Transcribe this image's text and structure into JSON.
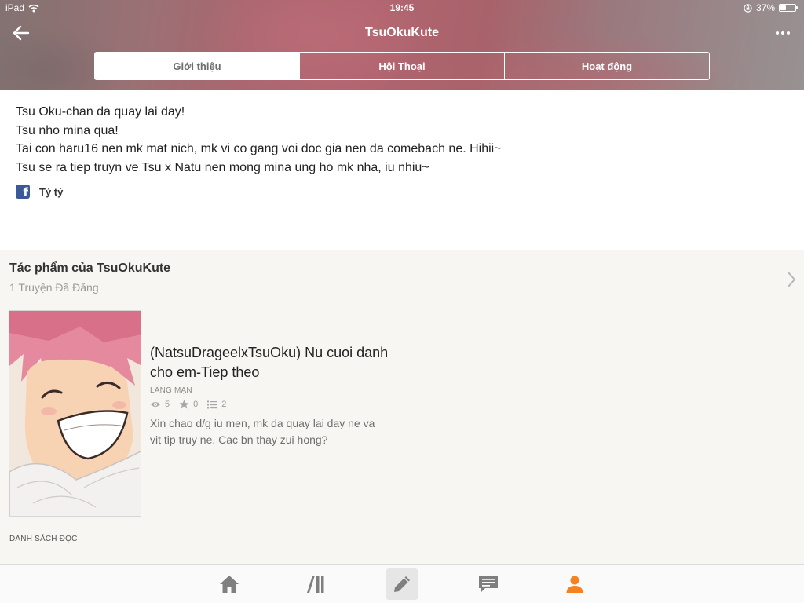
{
  "status_bar": {
    "carrier": "iPad",
    "time": "19:45",
    "battery_text": "37%",
    "battery_level": 0.37
  },
  "header": {
    "profile_name": "TsuOkuKute",
    "back_icon": "arrow-left-icon",
    "more_icon": "more-horizontal-icon",
    "tabs": [
      {
        "label": "Giới thiệu",
        "active": true
      },
      {
        "label": "Hội Thoại",
        "active": false
      },
      {
        "label": "Hoạt động",
        "active": false
      }
    ]
  },
  "about": {
    "lines": [
      "Tsu Oku-chan da quay lai day!",
      "Tsu nho mina qua!",
      "Tai con haru16 nen mk mat nich, mk vi co gang voi doc gia nen da comebach ne. Hihii~",
      "Tsu se ra tiep truyn ve Tsu x Natu nen mong mina ung ho mk nha, iu nhiu~"
    ],
    "social": {
      "icon": "facebook-icon",
      "label": "Tý tỷ"
    }
  },
  "works": {
    "title": "Tác phẩm của TsuOkuKute",
    "count_text": "1 Truyện Đã Đăng",
    "stories": [
      {
        "title": "(NatsuDrageelxTsuOku) Nu cuoi danh cho em-Tiep theo",
        "genre": "LÃNG MẠN",
        "reads": "5",
        "votes": "0",
        "parts": "2",
        "description": "Xin chao d/g iu men, mk da quay lai day ne va vit tip truy ne. Cac bn thay zui hong?"
      }
    ],
    "reading_list_label": "DANH SÁCH ĐỌC"
  },
  "tab_bar": {
    "items": [
      {
        "name": "home",
        "icon": "home-icon"
      },
      {
        "name": "library",
        "icon": "library-icon"
      },
      {
        "name": "write",
        "icon": "pencil-icon"
      },
      {
        "name": "messages",
        "icon": "chat-icon"
      },
      {
        "name": "profile",
        "icon": "user-icon"
      }
    ]
  },
  "colors": {
    "accent": "#f58220",
    "facebook": "#3b5998",
    "section_background": "#f7f6f2",
    "muted_text": "#9a9a9a"
  }
}
